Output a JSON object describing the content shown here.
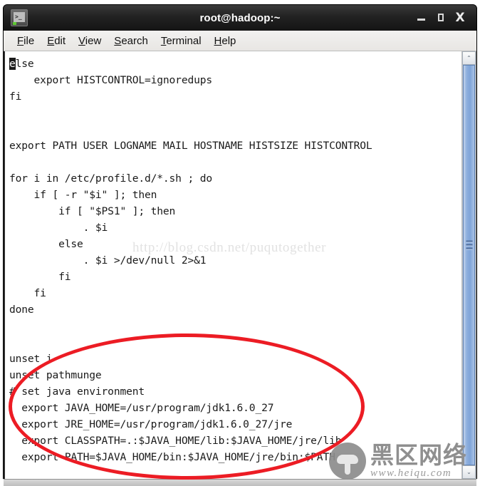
{
  "window": {
    "title": "root@hadoop:~",
    "app_icon": "terminal-icon",
    "icon_prompt_glyph": ">_",
    "controls": {
      "minimize_label": "_",
      "maximize_label": "□",
      "close_label": "X"
    }
  },
  "menubar": {
    "items": [
      {
        "label": "File",
        "mnemonic": "F"
      },
      {
        "label": "Edit",
        "mnemonic": "E"
      },
      {
        "label": "View",
        "mnemonic": "V"
      },
      {
        "label": "Search",
        "mnemonic": "S"
      },
      {
        "label": "Terminal",
        "mnemonic": "T"
      },
      {
        "label": "Help",
        "mnemonic": "H"
      }
    ]
  },
  "terminal": {
    "cursor": {
      "line_index": 0,
      "column": 0,
      "char": "e"
    },
    "lines": [
      "else",
      "    export HISTCONTROL=ignoredups",
      "fi",
      "",
      "",
      "export PATH USER LOGNAME MAIL HOSTNAME HISTSIZE HISTCONTROL",
      "",
      "for i in /etc/profile.d/*.sh ; do",
      "    if [ -r \"$i\" ]; then",
      "        if [ \"$PS1\" ]; then",
      "            . $i",
      "        else",
      "            . $i >/dev/null 2>&1",
      "        fi",
      "    fi",
      "done",
      "",
      "",
      "unset i",
      "unset pathmunge",
      "# set java environment",
      "  export JAVA_HOME=/usr/program/jdk1.6.0_27",
      "  export JRE_HOME=/usr/program/jdk1.6.0_27/jre",
      "  export CLASSPATH=.:$JAVA_HOME/lib:$JAVA_HOME/jre/lib",
      "  export PATH=$JAVA_HOME/bin:$JAVA_HOME/jre/bin:$PATH",
      ""
    ]
  },
  "scrollbar": {
    "up_arrow": "⌃",
    "down_arrow": "⌄",
    "thumb_position_percent": 0,
    "thumb_size_percent": 100
  },
  "annotations": {
    "highlight_ellipse": {
      "color": "#ec1c24",
      "targets": "java environment export block"
    }
  },
  "watermarks": {
    "blog_url": "http://blog.csdn.net/puqutogether",
    "brand_cn": "黑区网络",
    "brand_url": "www.heiqu.com"
  },
  "colors": {
    "titlebar": "#1d1d1d",
    "menubar": "#edebe8",
    "terminal_bg": "#ffffff",
    "terminal_fg": "#1a1a1a",
    "scrollbar_thumb": "#8fb0de",
    "annotation_red": "#ec1c24"
  }
}
